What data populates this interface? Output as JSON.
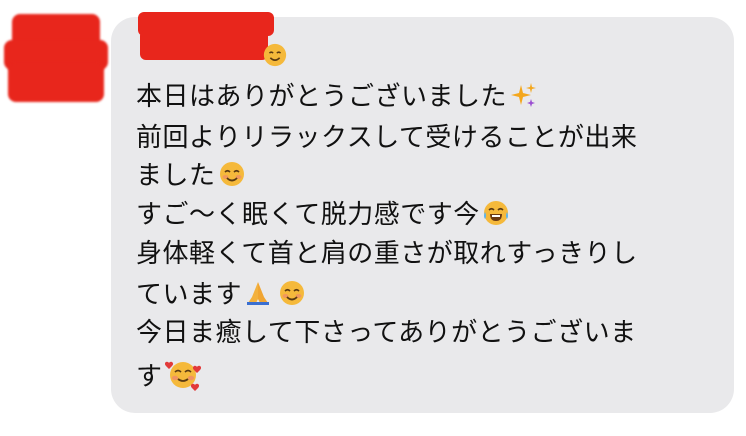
{
  "chat": {
    "lines": [
      {
        "text": "本日はありがとうございました",
        "emoji": "sparkles-icon"
      },
      {
        "text": "前回よりリラックスして受けることが出来",
        "emoji": ""
      },
      {
        "text": "ました",
        "emoji": "smiling-face-icon"
      },
      {
        "text": "すご〜く眠くて脱力感です今",
        "emoji": "tears-of-joy-icon"
      },
      {
        "text": "身体軽くて首と肩の重さが取れすっきりし",
        "emoji": ""
      },
      {
        "text": "ています",
        "emoji": "folded-hands-icon"
      },
      {
        "text": "今日ま癒して下さってありがとうございま",
        "emoji": ""
      },
      {
        "text": "す",
        "emoji": "smiling-face-with-hearts-icon"
      }
    ]
  },
  "colors": {
    "bubble_bg": "#e9e9eb",
    "redaction": "#e8261c",
    "text": "#111111"
  }
}
